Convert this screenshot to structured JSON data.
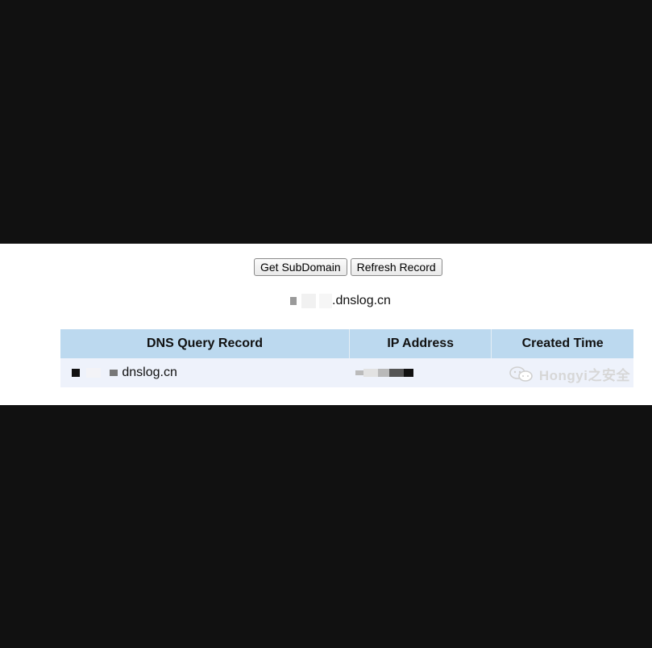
{
  "toolbar": {
    "get_subdomain_label": "Get SubDomain",
    "refresh_record_label": "Refresh Record"
  },
  "subdomain": {
    "suffix": ".dnslog.cn"
  },
  "table": {
    "headers": [
      "DNS Query Record",
      "IP Address",
      "Created Time"
    ],
    "rows": [
      {
        "dns_query_suffix": "dnslog.cn",
        "ip_address": "",
        "created_time": ""
      }
    ]
  },
  "watermark": {
    "text": "Hongyi之安全"
  }
}
